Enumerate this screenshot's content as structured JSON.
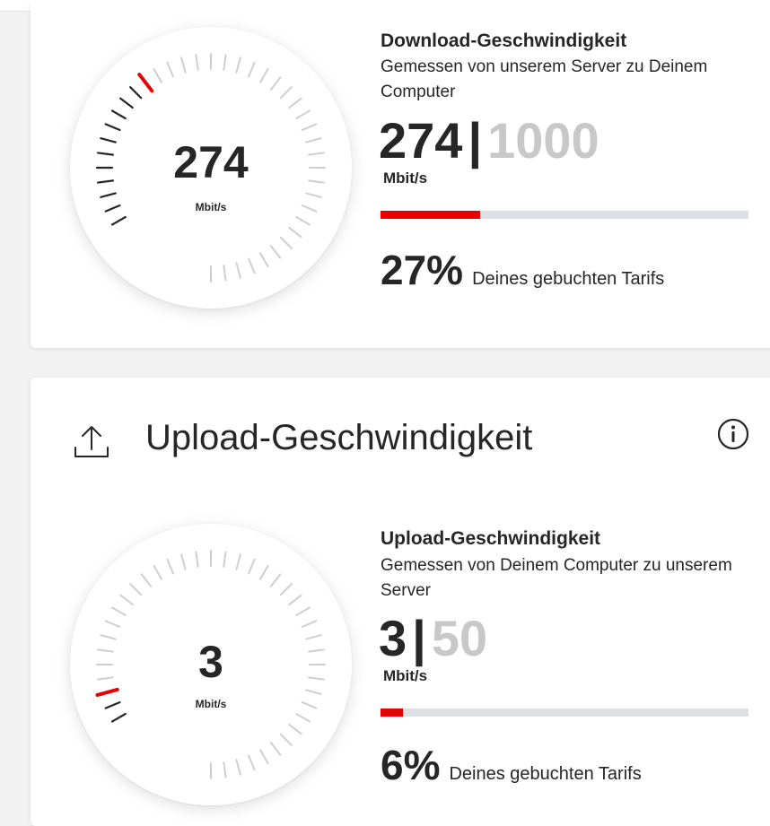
{
  "colors": {
    "accent": "#e60000",
    "tick_inactive": "#cfcfcf",
    "tick_dark": "#262626",
    "bar_track": "#dde1e6",
    "max_value": "#c8c8c8"
  },
  "download": {
    "gauge_value": "274",
    "gauge_unit": "Mbit/s",
    "gauge_fraction": 0.274,
    "title": "Download-Geschwindigkeit",
    "description": "Gemessen von unserem Server zu Deinem Computer",
    "measured": "274",
    "separator": "|",
    "max": "1000",
    "unit": "Mbit/s",
    "bar_fraction": 0.27,
    "percent": "27%",
    "percent_label": "Deines gebuchten Tarifs"
  },
  "upload": {
    "section_title": "Upload-Geschwindigkeit",
    "section_icon": "upload-icon",
    "info_icon": "info-icon",
    "gauge_value": "3",
    "gauge_unit": "Mbit/s",
    "gauge_fraction": 0.06,
    "title": "Upload-Geschwindigkeit",
    "description": "Gemessen von Deinem Computer zu unserem Server",
    "measured": "3",
    "separator": "|",
    "max": "50",
    "unit": "Mbit/s",
    "bar_fraction": 0.06,
    "percent": "6%",
    "percent_label": "Deines gebuchten Tarifs"
  }
}
